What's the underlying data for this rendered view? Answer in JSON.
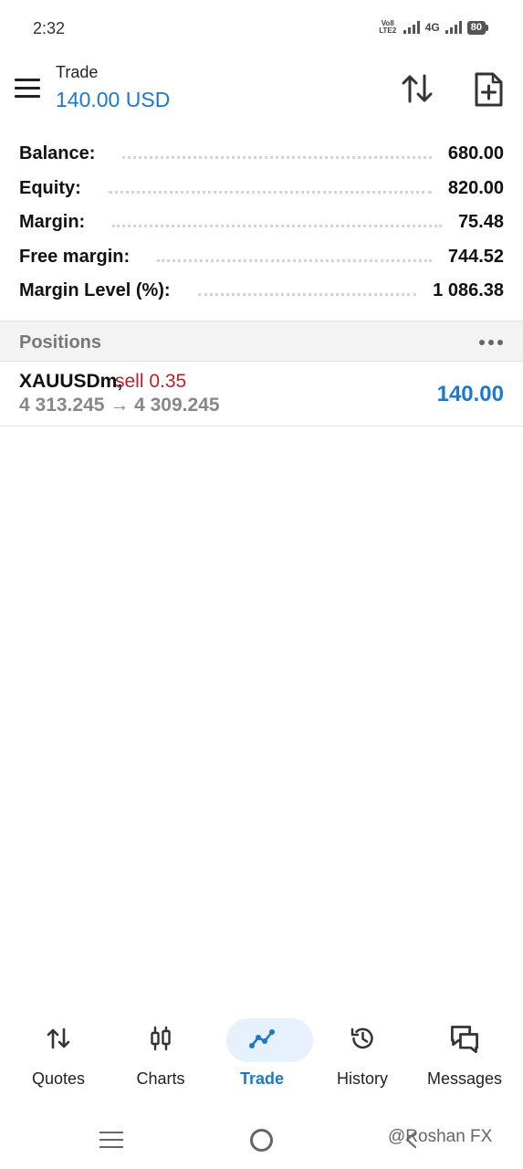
{
  "status_bar": {
    "time": "2:32",
    "volte_label": "Vo8 LTE2",
    "network": "4G",
    "battery": "80"
  },
  "header": {
    "title": "Trade",
    "subtitle": "140.00 USD"
  },
  "summary": [
    {
      "label": "Balance:",
      "value": "680.00"
    },
    {
      "label": "Equity:",
      "value": "820.00"
    },
    {
      "label": "Margin:",
      "value": "75.48"
    },
    {
      "label": "Free margin:",
      "value": "744.52"
    },
    {
      "label": "Margin Level (%):",
      "value": "1 086.38"
    }
  ],
  "positions": {
    "header": "Positions",
    "items": [
      {
        "symbol": "XAUUSDm,",
        "side": "sell 0.35",
        "prices": "4 313.245 → 4 309.245",
        "profit": "140.00"
      }
    ]
  },
  "bottom_nav": {
    "items": [
      {
        "label": "Quotes",
        "icon": "quotes-icon"
      },
      {
        "label": "Charts",
        "icon": "charts-icon"
      },
      {
        "label": "Trade",
        "icon": "trade-icon",
        "active": true
      },
      {
        "label": "History",
        "icon": "history-icon"
      },
      {
        "label": "Messages",
        "icon": "messages-icon"
      }
    ]
  },
  "watermark": "@Roshan FX",
  "colors": {
    "accent": "#1e78c8",
    "sell": "#c0202a",
    "active_pill": "#e6f1fb"
  }
}
